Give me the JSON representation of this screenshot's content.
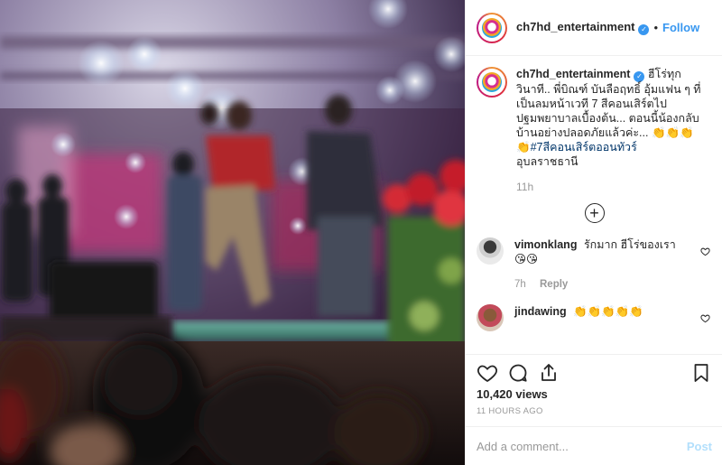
{
  "account": {
    "username": "ch7hd_entertainment",
    "verified": true,
    "follow_label": "Follow",
    "dot": "•"
  },
  "caption": {
    "text": "ฮีโร่ทุกวินาที.. พี่บิณฑ์ บันลือฤทธิ์ อุ้มแฟน ๆ ที่เป็นลมหน้าเวที 7 สีคอนเสิร์ตไปปฐมพยาบาลเบื้องต้น... ตอนนี้น้องกลับบ้านอย่างปลอดภัยแล้วค่ะ... 👏👏👏👏",
    "hashtag": "#7สีคอนเสิร์ตออนทัวร์",
    "location_text": "อุบลราชธานี",
    "time": "11h"
  },
  "comments": [
    {
      "username": "vimonklang",
      "text": "รักมาก ฮีโร่ของเรา 😘😘",
      "time": "7h",
      "reply_label": "Reply"
    },
    {
      "username": "jindawing",
      "text": "👏👏👏👏👏",
      "time": "",
      "reply_label": ""
    }
  ],
  "stats": {
    "views": "10,420 views",
    "time_ago": "11 HOURS AGO"
  },
  "composer": {
    "placeholder": "Add a comment...",
    "post_label": "Post"
  },
  "icons": {
    "like": "heart-icon",
    "comment": "comment-icon",
    "share": "share-icon",
    "save": "bookmark-icon",
    "load_more": "plus-circle-icon"
  },
  "colors": {
    "accent": "#3897f0",
    "muted": "#999999",
    "hashtag": "#003569",
    "post_disabled": "#b2dffc"
  }
}
